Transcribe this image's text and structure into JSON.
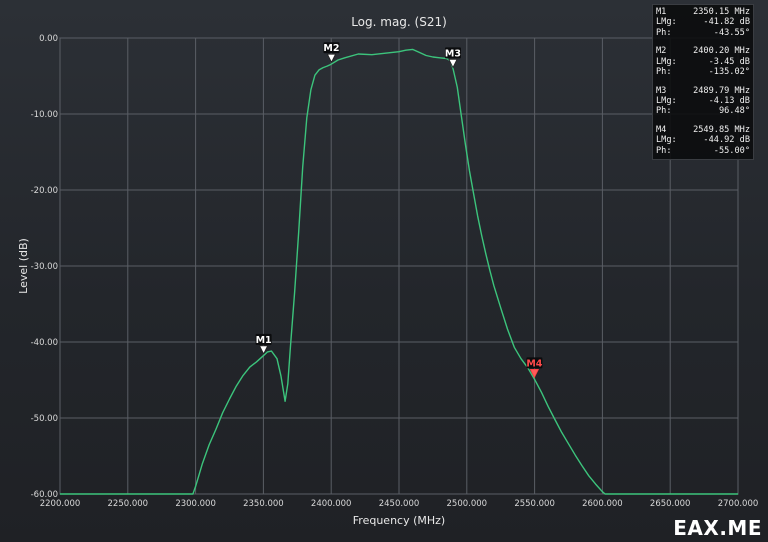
{
  "chart_data": {
    "type": "line",
    "title": "Log. mag. (S21)",
    "xlabel": "Frequency (MHz)",
    "ylabel": "Level (dB)",
    "xlim": [
      2200,
      2700
    ],
    "ylim": [
      -60,
      0
    ],
    "xticks": [
      2200,
      2250,
      2300,
      2350,
      2400,
      2450,
      2500,
      2550,
      2600,
      2650,
      2700
    ],
    "xtick_labels": [
      "2200.000",
      "2250.000",
      "2300.000",
      "2350.000",
      "2400.000",
      "2450.000",
      "2500.000",
      "2550.000",
      "2600.000",
      "2650.000",
      "2700.000"
    ],
    "yticks": [
      0,
      -10,
      -20,
      -30,
      -40,
      -50,
      -60
    ],
    "ytick_labels": [
      "0.00",
      "-10.00",
      "-20.00",
      "-30.00",
      "-40.00",
      "-50.00",
      "-60.00"
    ],
    "grid": true,
    "series": [
      {
        "color": "#3cc47c",
        "x": [
          2200,
          2298,
          2300,
          2305,
          2310,
          2315,
          2320,
          2325,
          2330,
          2335,
          2340,
          2345,
          2350,
          2353,
          2356,
          2360,
          2363,
          2366,
          2368,
          2370,
          2373,
          2376,
          2379,
          2382,
          2385,
          2388,
          2391,
          2394,
          2397,
          2400,
          2405,
          2410,
          2420,
          2430,
          2440,
          2450,
          2455,
          2460,
          2465,
          2470,
          2475,
          2480,
          2485,
          2488,
          2490,
          2493,
          2496,
          2499,
          2502,
          2505,
          2508,
          2511,
          2514,
          2517,
          2520,
          2525,
          2530,
          2535,
          2540,
          2545,
          2550,
          2555,
          2560,
          2565,
          2570,
          2575,
          2580,
          2585,
          2590,
          2595,
          2600,
          2602,
          2610,
          2700
        ],
        "y": [
          -60,
          -60,
          -59,
          -56,
          -53.5,
          -51.5,
          -49.3,
          -47.5,
          -45.8,
          -44.4,
          -43.3,
          -42.6,
          -41.8,
          -41.3,
          -41.2,
          -42.2,
          -44.5,
          -47.8,
          -45.5,
          -40.5,
          -33.5,
          -25.5,
          -17,
          -10.5,
          -6.8,
          -4.9,
          -4.2,
          -3.9,
          -3.7,
          -3.45,
          -2.9,
          -2.6,
          -2.1,
          -2.2,
          -2.0,
          -1.8,
          -1.6,
          -1.5,
          -1.9,
          -2.3,
          -2.5,
          -2.6,
          -2.7,
          -3.0,
          -4.13,
          -6.5,
          -10.3,
          -14.0,
          -17.5,
          -20.5,
          -23.4,
          -26.0,
          -28.4,
          -30.6,
          -32.6,
          -35.5,
          -38.3,
          -40.7,
          -42.2,
          -43.4,
          -44.92,
          -46.6,
          -48.5,
          -50.2,
          -51.9,
          -53.4,
          -54.9,
          -56.3,
          -57.6,
          -58.7,
          -59.7,
          -60,
          -60,
          -60
        ]
      }
    ],
    "markers": [
      {
        "label": "M1",
        "freq": "2350.15 MHz",
        "lmg": "-41.82 dB",
        "ph": "-43.55°",
        "x": 2350.15,
        "y": -41.82,
        "active": false
      },
      {
        "label": "M2",
        "freq": "2400.20 MHz",
        "lmg": "-3.45 dB",
        "ph": "-135.02°",
        "x": 2400.2,
        "y": -3.45,
        "active": false
      },
      {
        "label": "M3",
        "freq": "2489.79 MHz",
        "lmg": "-4.13 dB",
        "ph": "96.48°",
        "x": 2489.79,
        "y": -4.13,
        "active": false
      },
      {
        "label": "M4",
        "freq": "2549.85 MHz",
        "lmg": "-44.92 dB",
        "ph": "-55.00°",
        "x": 2549.85,
        "y": -44.92,
        "active": true
      }
    ]
  },
  "marker_panel": {
    "lmg_label": "LMg:",
    "ph_label": "Ph:"
  },
  "watermark": "EAX.ME"
}
